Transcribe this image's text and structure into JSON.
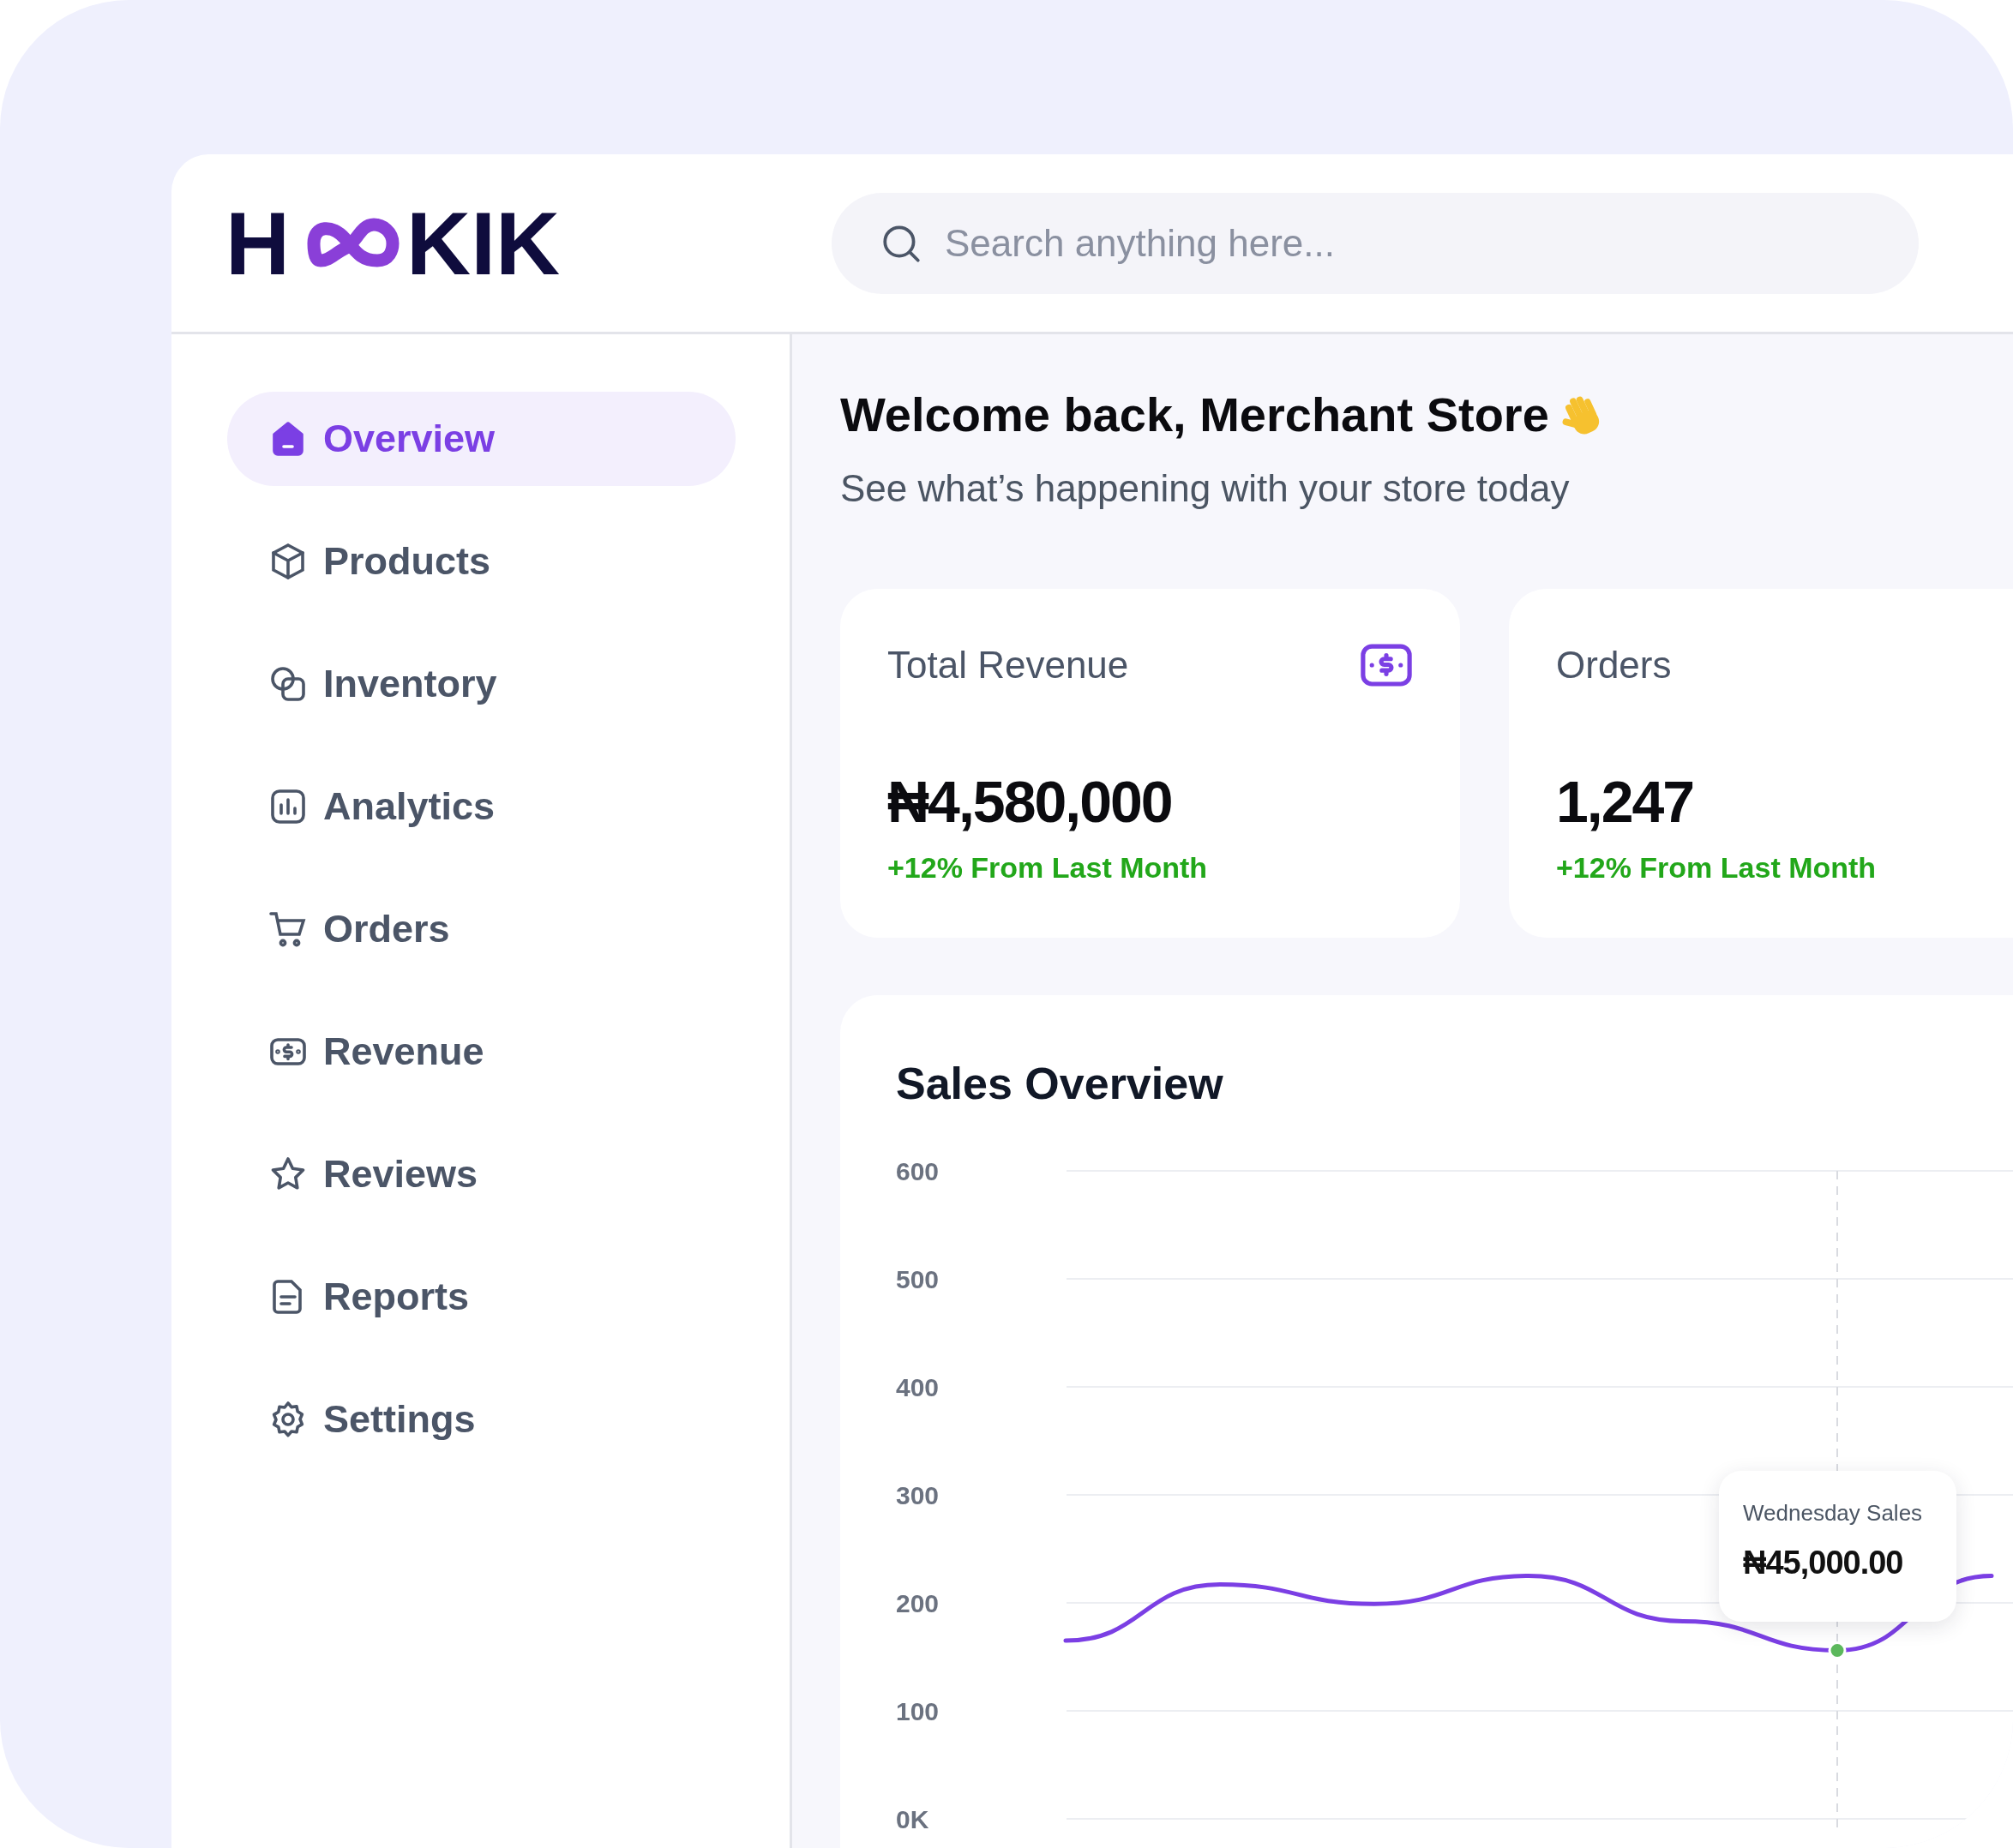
{
  "logo": {
    "left": "H",
    "right": "KIK"
  },
  "search": {
    "placeholder": "Search anything here..."
  },
  "sidebar": {
    "items": [
      {
        "label": "Overview",
        "selected": true
      },
      {
        "label": "Products",
        "selected": false
      },
      {
        "label": "Inventory",
        "selected": false
      },
      {
        "label": "Analytics",
        "selected": false
      },
      {
        "label": "Orders",
        "selected": false
      },
      {
        "label": "Revenue",
        "selected": false
      },
      {
        "label": "Reviews",
        "selected": false
      },
      {
        "label": "Reports",
        "selected": false
      },
      {
        "label": "Settings",
        "selected": false
      }
    ]
  },
  "welcome": {
    "title": "Welcome back, Merchant Store",
    "subtitle": "See what’s happening with your store today"
  },
  "stats": [
    {
      "title": "Total Revenue",
      "value": "₦4,580,000",
      "change": "+12% From Last Month"
    },
    {
      "title": "Orders",
      "value": "1,247",
      "change": "+12% From Last Month"
    }
  ],
  "sales": {
    "title": "Sales Overview",
    "tooltip": {
      "title": "Wednesday Sales",
      "value": "₦45,000.00"
    },
    "chart_data": {
      "type": "line",
      "ylim": [
        0,
        600
      ],
      "grid": true,
      "yticks": [
        {
          "value": 0,
          "label": "0K"
        },
        100,
        200,
        300,
        400,
        500,
        600
      ],
      "series": [
        {
          "color": "#7b3fe4",
          "values": [
            165,
            217,
            199,
            225,
            183,
            156,
            225
          ]
        }
      ]
    }
  }
}
